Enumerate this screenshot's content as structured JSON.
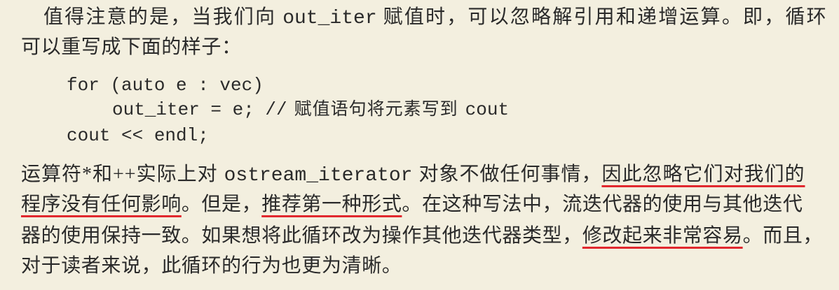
{
  "colors": {
    "background": "#f3efdf",
    "text": "#2a2a2a",
    "underline": "#e1282e"
  },
  "intro": {
    "line1": {
      "before_code": "值得注意的是，当我们向",
      "code": "out_iter",
      "after_code": "赋值时，可以忽略解引用和递增运算。即，循环"
    },
    "line2": "可以重写成下面的样子："
  },
  "code_block": {
    "line1": "for (auto e : vec)",
    "line2": {
      "code": "out_iter = e; //",
      "comment": "赋值语句将元素写到",
      "code_tail": "cout"
    },
    "line3": "cout << endl;"
  },
  "body": {
    "line1": {
      "before_code": "运算符*和++实际上对",
      "code": "ostream_iterator",
      "after_code": "对象不做任何事情，",
      "underlined": "因此忽略它们对我们的"
    },
    "line2": {
      "underlined_1": "程序没有任何影响",
      "middle": "。但是，",
      "underlined_2": "推荐第一种形式",
      "rest": "。在这种写法中，流迭代器的使用与其他迭代"
    },
    "line3": {
      "before": "器的使用保持一致。如果想将此循环改为操作其他迭代器类型，",
      "underlined": "修改起来非常容易",
      "after": "。而且，"
    },
    "line4": "对于读者来说，此循环的行为也更为清晰。"
  }
}
